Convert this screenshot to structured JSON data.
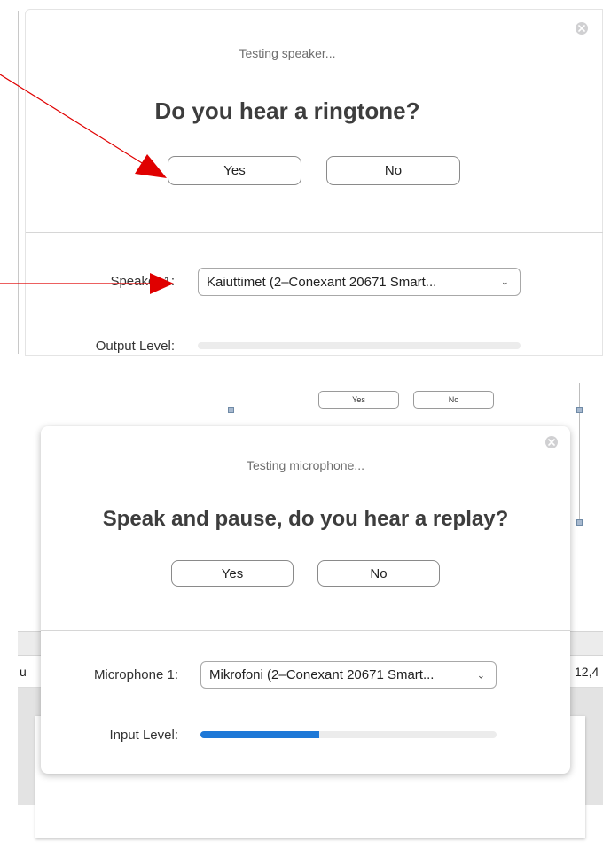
{
  "speaker_dialog": {
    "status": "Testing speaker...",
    "question": "Do you hear a ringtone?",
    "yes_label": "Yes",
    "no_label": "No",
    "device_label": "Speaker 1:",
    "device_value": "Kaiuttimet (2–Conexant 20671 Smart...",
    "level_label": "Output Level:",
    "level_value": 0,
    "close_icon": "close-icon"
  },
  "background": {
    "mini_yes_label": "Yes",
    "mini_no_label": "No",
    "row_left_text": "u",
    "row_right_text": "12,4"
  },
  "mic_dialog": {
    "status": "Testing microphone...",
    "question": "Speak and pause, do you hear a replay?",
    "yes_label": "Yes",
    "no_label": "No",
    "device_label": "Microphone 1:",
    "device_value": "Mikrofoni (2–Conexant 20671 Smart...",
    "level_label": "Input Level:",
    "level_value": 0.4,
    "close_icon": "close-icon"
  },
  "annotations": {
    "arrow_color": "#e00000",
    "accent_color": "#1e78d7"
  }
}
